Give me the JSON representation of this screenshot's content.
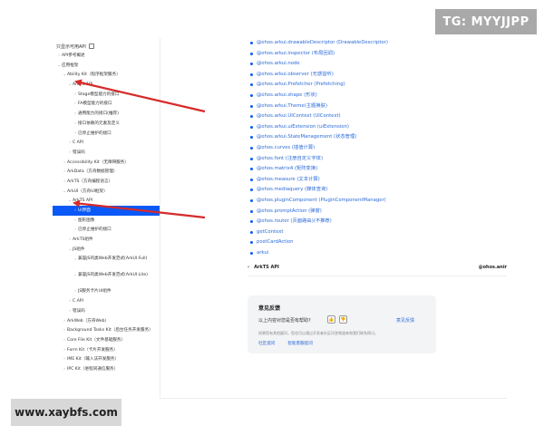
{
  "watermarks": {
    "top_right": "TG: MYYJJPP",
    "bottom_left": "www.xaybfs.com"
  },
  "sidebar": {
    "filter_label": "只显示可用API",
    "items": [
      {
        "label": "API参考概述",
        "depth": 0,
        "chevron": "›"
      },
      {
        "label": "应用框架",
        "depth": 0,
        "chevron": "⌄"
      },
      {
        "label": "Ability Kit（程序框架服务）",
        "depth": 1,
        "chevron": "⌄"
      },
      {
        "label": "ArkTS API",
        "depth": 2,
        "chevron": "⌄"
      },
      {
        "label": "Stage模型能力的接口",
        "depth": 3,
        "chevron": "›"
      },
      {
        "label": "FA模型能力的接口",
        "depth": 3,
        "chevron": "›"
      },
      {
        "label": "通用能力的接口(推荐)",
        "depth": 3,
        "chevron": "›"
      },
      {
        "label": "接口依赖的元素及定义",
        "depth": 3,
        "chevron": "›"
      },
      {
        "label": "已停止维护的接口",
        "depth": 3,
        "chevron": "›"
      },
      {
        "label": "C API",
        "depth": 2,
        "chevron": "›"
      },
      {
        "label": "错误码",
        "depth": 2,
        "chevron": "›"
      },
      {
        "label": "Accessibility Kit（无障碍服务）",
        "depth": 1,
        "chevron": "›"
      },
      {
        "label": "ArkData（方舟数据管理）",
        "depth": 1,
        "chevron": "›"
      },
      {
        "label": "ArkTS（方舟编程语言）",
        "depth": 1,
        "chevron": "›"
      },
      {
        "label": "ArkUI（方舟UI框架）",
        "depth": 1,
        "chevron": "⌄"
      },
      {
        "label": "ArkTS API",
        "depth": 2,
        "chevron": "⌄"
      },
      {
        "label": "UI界面",
        "depth": 3,
        "chevron": "›",
        "selected": true
      },
      {
        "label": "图形图像",
        "depth": 3,
        "chevron": "›"
      },
      {
        "label": "已停止维护的接口",
        "depth": 3,
        "chevron": "›"
      },
      {
        "label": "ArkTS组件",
        "depth": 2,
        "chevron": "›"
      },
      {
        "label": "JS组件",
        "depth": 2,
        "chevron": "⌄"
      },
      {
        "label": "兼容JS的类Web开发范式(ArkUI.Full)",
        "depth": 3,
        "chevron": "›",
        "tall": true
      },
      {
        "label": "兼容JS的类Web开发范式(ArkUI.Lite)",
        "depth": 3,
        "chevron": "›",
        "tall": true
      },
      {
        "label": "JS服务卡片UI组件",
        "depth": 3,
        "chevron": "›"
      },
      {
        "label": "C API",
        "depth": 2,
        "chevron": "›"
      },
      {
        "label": "错误码",
        "depth": 2,
        "chevron": "›"
      },
      {
        "label": "ArkWeb（方舟Web）",
        "depth": 1,
        "chevron": "›"
      },
      {
        "label": "Background Tasks Kit（后台任务开发服务）",
        "depth": 1,
        "chevron": "›"
      },
      {
        "label": "Core File Kit（文件基础服务）",
        "depth": 1,
        "chevron": "›"
      },
      {
        "label": "Form Kit（卡片开发服务）",
        "depth": 1,
        "chevron": "›"
      },
      {
        "label": "IME Kit（输入法开发服务）",
        "depth": 1,
        "chevron": "›"
      },
      {
        "label": "IPC Kit（进程间通信服务）",
        "depth": 1,
        "chevron": "›"
      }
    ]
  },
  "content": {
    "links": [
      "@ohos.arkui.drawableDescriptor (DrawableDescriptor)",
      "@ohos.arkui.inspector (布局回调)",
      "@ohos.arkui.node",
      "@ohos.arkui.observer (无感监听)",
      "@ohos.arkui.Prefetcher (Prefetching)",
      "@ohos.arkui.shape (形状)",
      "@ohos.arkui.Theme(主题换肤)",
      "@ohos.arkui.UIContext (UIContext)",
      "@ohos.arkui.uiExtension (uiExtension)",
      "@ohos.arkui.StateManagement (状态管理)",
      "@ohos.curves (插值计算)",
      "@ohos.font (注册自定义字体)",
      "@ohos.matrix4 (矩阵变换)",
      "@ohos.measure (文本计算)",
      "@ohos.mediaquery (媒体查询)",
      "@ohos.pluginComponent (PluginComponentManager)",
      "@ohos.promptAction (弹窗)",
      "@ohos.router (页面路由)(不推荐)",
      "getContext",
      "postCardAction",
      "arkui"
    ],
    "pager": {
      "prev_arrow": "‹",
      "prev_label": "ArkTS API",
      "next_label": "@ohos.anir"
    },
    "feedback": {
      "title": "意见反馈",
      "question": "以上内容对您是否有帮助?",
      "thumb_up": "👍",
      "thumb_down": "👎",
      "suggest": "意见反馈",
      "note": "如果您有其他疑问，您也可以通过开发者社区问答频道来和我们联系探讨。",
      "link1": "社区提问",
      "link2": "智能客服提问"
    }
  },
  "colors": {
    "accent": "#0a59f7",
    "link": "#2a6ad8",
    "arrow": "#d62a2a"
  }
}
